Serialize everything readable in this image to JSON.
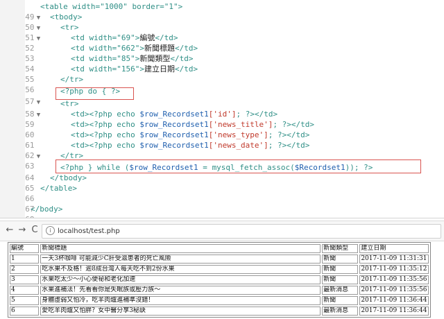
{
  "editor": {
    "lines": [
      {
        "n": "49",
        "fold": "▼"
      },
      {
        "n": "50",
        "fold": "▼"
      },
      {
        "n": "51",
        "fold": "▼"
      },
      {
        "n": "52",
        "fold": ""
      },
      {
        "n": "53",
        "fold": ""
      },
      {
        "n": "54",
        "fold": ""
      },
      {
        "n": "55",
        "fold": ""
      },
      {
        "n": "56",
        "fold": ""
      },
      {
        "n": "57",
        "fold": "▼"
      },
      {
        "n": "58",
        "fold": "▼"
      },
      {
        "n": "59",
        "fold": ""
      },
      {
        "n": "60",
        "fold": ""
      },
      {
        "n": "61",
        "fold": ""
      },
      {
        "n": "62",
        "fold": "▼"
      },
      {
        "n": "63",
        "fold": ""
      },
      {
        "n": "64",
        "fold": ""
      },
      {
        "n": "65",
        "fold": ""
      },
      {
        "n": "66",
        "fold": ""
      },
      {
        "n": "67",
        "fold": ""
      },
      {
        "n": "68",
        "fold": ""
      },
      {
        "n": "69",
        "fold": ""
      }
    ],
    "code": {
      "l49": "<table width=\"1000\" border=\"1\">",
      "l50": "<tbody>",
      "l51": "<tr>",
      "l52a": "<td width=\"69\">",
      "l52b": "編號",
      "l52c": "</td>",
      "l53a": "<td width=\"662\">",
      "l53b": "新聞標題",
      "l53c": "</td>",
      "l54a": "<td width=\"85\">",
      "l54b": "新聞類型",
      "l54c": "</td>",
      "l55a": "<td width=\"156\">",
      "l55b": "建立日期",
      "l55c": "</td>",
      "l56": "</tr>",
      "l57": "<?php do { ?>",
      "l58": "<tr>",
      "l59a": "<td>",
      "l59b": "<?php echo ",
      "l59c": "$row_Recordset1",
      "l59d": "['id']",
      "l59e": "; ?>",
      "l59f": "</td>",
      "l60a": "<td>",
      "l60b": "<?php echo ",
      "l60c": "$row_Recordset1",
      "l60d": "['news_title']",
      "l60e": "; ?>",
      "l60f": "</td>",
      "l61a": "<td>",
      "l61b": "<?php echo ",
      "l61c": "$row_Recordset1",
      "l61d": "['news_type']",
      "l61e": "; ?>",
      "l61f": "</td>",
      "l62a": "<td>",
      "l62b": "<?php echo ",
      "l62c": "$row_Recordset1",
      "l62d": "['news_date']",
      "l62e": "; ?>",
      "l62f": "</td>",
      "l63": "</tr>",
      "l64a": "<?php } while (",
      "l64b": "$row_Recordset1",
      "l64c": " = ",
      "l64d": "mysql_fetch_assoc",
      "l64e": "(",
      "l64f": "$Recordset1",
      "l64g": ")); ?>",
      "l65": "</tbody>",
      "l66": "</table>",
      "l67": "",
      "l68": "</body>",
      "l69": ""
    }
  },
  "browser": {
    "back": "←",
    "forward": "→",
    "reload": "C",
    "info": "i",
    "url": "localhost/test.php"
  },
  "table": {
    "headers": [
      "編號",
      "新聞標題",
      "新聞類型",
      "建立日期"
    ],
    "rows": [
      [
        "1",
        "一天3杯咖啡 可能減少C肝受滋患者的死亡風險",
        "新聞",
        "2017-11-09 11:31:31"
      ],
      [
        "2",
        "吃水果不及格！逾8成台灣人每天吃不到2份水果",
        "新聞",
        "2017-11-09 11:35:12"
      ],
      [
        "3",
        "水果吃太少～小心便祕和老化加速",
        "新聞",
        "2017-11-09 11:35:56"
      ],
      [
        "4",
        "水果進補法！先看看你是失眠族或壓力族～",
        "最新消息",
        "2017-11-09 11:35:56"
      ],
      [
        "5",
        "身體虛弱又怕冷，吃羊肉爐進補準沒錯！",
        "新聞",
        "2017-11-09 11:36:44"
      ],
      [
        "6",
        "愛吃羊肉爐又怕胖？女中醫分享3秘訣",
        "最新消息",
        "2017-11-09 11:36:44"
      ]
    ]
  }
}
